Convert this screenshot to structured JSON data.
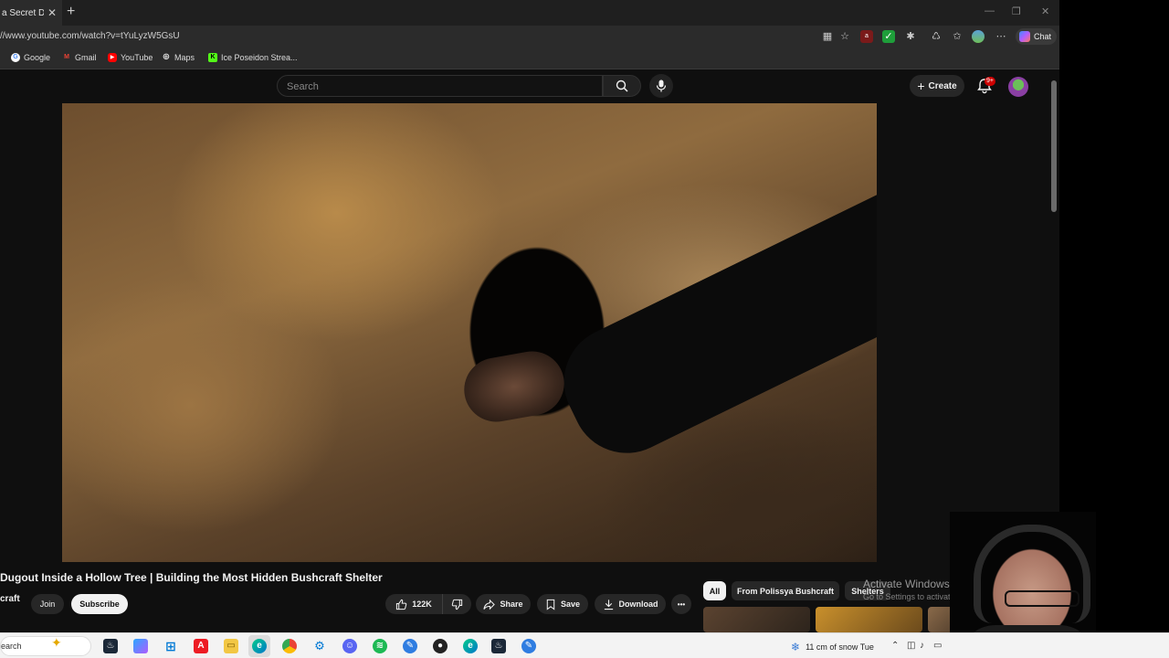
{
  "browser": {
    "tab": {
      "title": "a Secret Dugo",
      "close": "✕",
      "new_tab": "+"
    },
    "window_controls": {
      "minimize": "—",
      "restore": "❐",
      "close": "✕"
    },
    "url": "//www.youtube.com/watch?v=tYuLyzW5GsU",
    "chat_label": "Chat",
    "bookmarks": [
      {
        "label": "Google",
        "icon": "google-icon",
        "color": "#4285f4"
      },
      {
        "label": "Gmail",
        "icon": "gmail-icon",
        "color": "#ea4335"
      },
      {
        "label": "YouTube",
        "icon": "youtube-icon",
        "color": "#ff0000"
      },
      {
        "label": "Maps",
        "icon": "globe-icon",
        "color": "#9aa0a6"
      },
      {
        "label": "Ice Poseidon Strea...",
        "icon": "kick-icon",
        "color": "#53fc18"
      }
    ]
  },
  "youtube": {
    "search_placeholder": "Search",
    "create_label": "Create",
    "notifications_badge": "9+",
    "video": {
      "title": "Dugout Inside a Hollow Tree | Building the Most Hidden Bushcraft Shelter",
      "channel": "craft",
      "join_label": "Join",
      "subscribe_label": "Subscribe",
      "likes": "122K",
      "share_label": "Share",
      "save_label": "Save",
      "download_label": "Download",
      "more_label": "•••"
    },
    "chips": [
      {
        "label": "All",
        "active": true
      },
      {
        "label": "From Polissya Bushcraft",
        "active": false
      },
      {
        "label": "Shelters",
        "active": false
      }
    ]
  },
  "activation": {
    "line1": "Activate Windows",
    "line2": "Go to Settings to activate Windows."
  },
  "taskbar": {
    "search_label": "earch",
    "weather_text": "11 cm of snow Tue",
    "weather_icon": "snowflake-icon"
  },
  "colors": {
    "yt_bg": "#0f0f0f",
    "chip_bg": "#272727",
    "accent_red": "#cc0000"
  }
}
